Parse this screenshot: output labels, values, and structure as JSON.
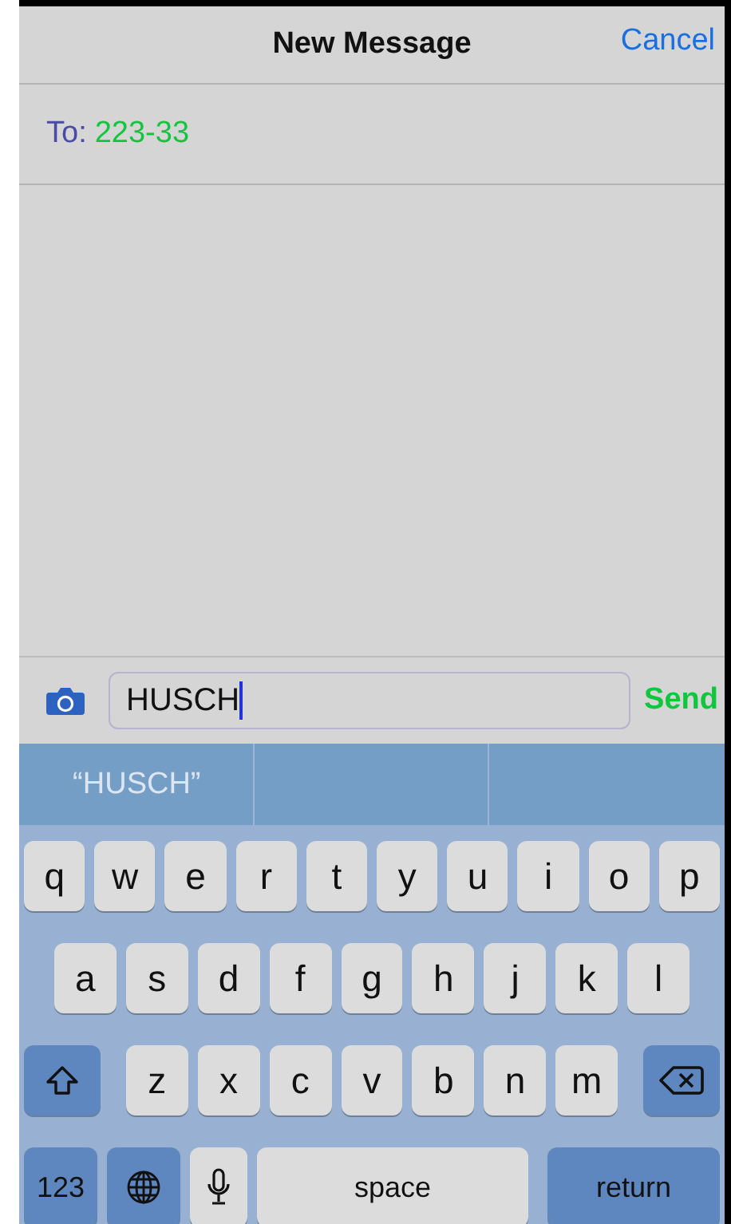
{
  "nav": {
    "title": "New Message",
    "cancel": "Cancel"
  },
  "recipient": {
    "label": "To:",
    "value": "223-33"
  },
  "compose": {
    "value": "HUSCH",
    "send": "Send"
  },
  "suggestions": [
    {
      "text": "“HUSCH”"
    }
  ],
  "keyboard": [
    {
      "keys": [
        {
          "kind": "letter",
          "label": "q"
        },
        {
          "kind": "letter",
          "label": "w"
        },
        {
          "kind": "letter",
          "label": "e"
        },
        {
          "kind": "letter",
          "label": "r"
        },
        {
          "kind": "letter",
          "label": "t"
        },
        {
          "kind": "letter",
          "label": "y"
        },
        {
          "kind": "letter",
          "label": "u"
        },
        {
          "kind": "letter",
          "label": "i"
        },
        {
          "kind": "letter",
          "label": "o"
        },
        {
          "kind": "letter",
          "label": "p"
        }
      ]
    },
    {
      "keys": [
        {
          "kind": "letter",
          "label": "a"
        },
        {
          "kind": "letter",
          "label": "s"
        },
        {
          "kind": "letter",
          "label": "d"
        },
        {
          "kind": "letter",
          "label": "f"
        },
        {
          "kind": "letter",
          "label": "g"
        },
        {
          "kind": "letter",
          "label": "h"
        },
        {
          "kind": "letter",
          "label": "j"
        },
        {
          "kind": "letter",
          "label": "k"
        },
        {
          "kind": "letter",
          "label": "l"
        }
      ]
    },
    {
      "keys": [
        {
          "kind": "shift"
        },
        {
          "kind": "letter",
          "label": "z"
        },
        {
          "kind": "letter",
          "label": "x"
        },
        {
          "kind": "letter",
          "label": "c"
        },
        {
          "kind": "letter",
          "label": "v"
        },
        {
          "kind": "letter",
          "label": "b"
        },
        {
          "kind": "letter",
          "label": "n"
        },
        {
          "kind": "letter",
          "label": "m"
        },
        {
          "kind": "delete"
        }
      ]
    },
    {
      "keys": [
        {
          "kind": "numbers",
          "label": "123"
        },
        {
          "kind": "globe"
        },
        {
          "kind": "mic"
        },
        {
          "kind": "space",
          "label": "space"
        },
        {
          "kind": "return",
          "label": "return"
        }
      ]
    }
  ]
}
